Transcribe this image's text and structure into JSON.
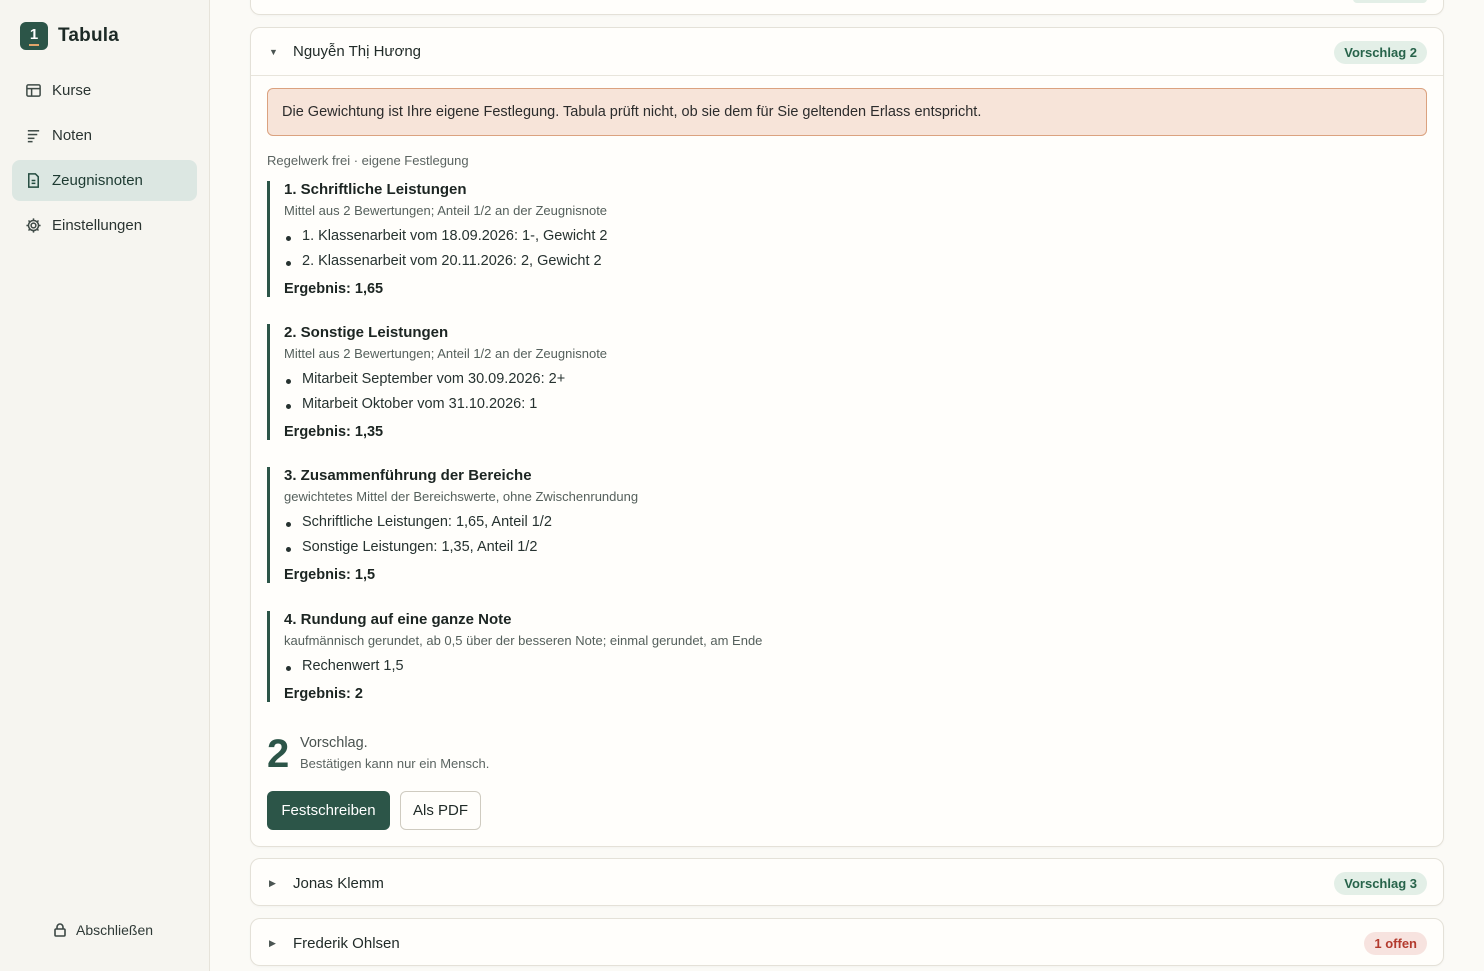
{
  "app": {
    "name": "Tabula",
    "logo_text": "1"
  },
  "sidebar": {
    "items": [
      {
        "label": "Kurse",
        "icon": "layout-icon",
        "active": false
      },
      {
        "label": "Noten",
        "icon": "list-icon",
        "active": false
      },
      {
        "label": "Zeugnisnoten",
        "icon": "document-icon",
        "active": true
      },
      {
        "label": "Einstellungen",
        "icon": "gear-icon",
        "active": false
      }
    ],
    "lock_label": "Abschließen"
  },
  "student_main": {
    "name": "Nguyễn Thị Hương",
    "badge": "Vorschlag 2",
    "warning": "Die Gewichtung ist Ihre eigene Festlegung. Tabula prüft nicht, ob sie dem für Sie geltenden Erlass entspricht.",
    "ruleset": "Regelwerk frei · eigene Festlegung",
    "steps": [
      {
        "title": "1. Schriftliche Leistungen",
        "desc": "Mittel aus 2 Bewertungen; Anteil 1/2 an der Zeugnisnote",
        "items": [
          "1. Klassenarbeit vom 18.09.2026: 1-, Gewicht 2",
          "2. Klassenarbeit vom 20.11.2026: 2, Gewicht 2"
        ],
        "result": "Ergebnis: 1,65"
      },
      {
        "title": "2. Sonstige Leistungen",
        "desc": "Mittel aus 2 Bewertungen; Anteil 1/2 an der Zeugnisnote",
        "items": [
          "Mitarbeit September vom 30.09.2026: 2+",
          "Mitarbeit Oktober vom 31.10.2026: 1"
        ],
        "result": "Ergebnis: 1,35"
      },
      {
        "title": "3. Zusammenführung der Bereiche",
        "desc": "gewichtetes Mittel der Bereichswerte, ohne Zwischenrundung",
        "items": [
          "Schriftliche Leistungen: 1,65, Anteil 1/2",
          "Sonstige Leistungen: 1,35, Anteil 1/2"
        ],
        "result": "Ergebnis: 1,5"
      },
      {
        "title": "4. Rundung auf eine ganze Note",
        "desc": "kaufmännisch gerundet, ab 0,5 über der besseren Note; einmal gerundet, am Ende",
        "items": [
          "Rechenwert 1,5"
        ],
        "result": "Ergebnis: 2"
      }
    ],
    "proposal_grade": "2",
    "proposal_label": "Vorschlag.",
    "proposal_note": "Bestätigen kann nur ein Mensch.",
    "btn_commit": "Festschreiben",
    "btn_pdf": "Als PDF"
  },
  "student_jonas": {
    "name": "Jonas Klemm",
    "badge": "Vorschlag 3"
  },
  "student_frederik": {
    "name": "Frederik Ohlsen",
    "badge": "1 offen"
  },
  "colors": {
    "accent": "#2c5548",
    "warning_bg": "#f7e4d9",
    "warning_border": "#dba27f",
    "badge_ok": "#27634a",
    "badge_open": "#b33b2e"
  }
}
